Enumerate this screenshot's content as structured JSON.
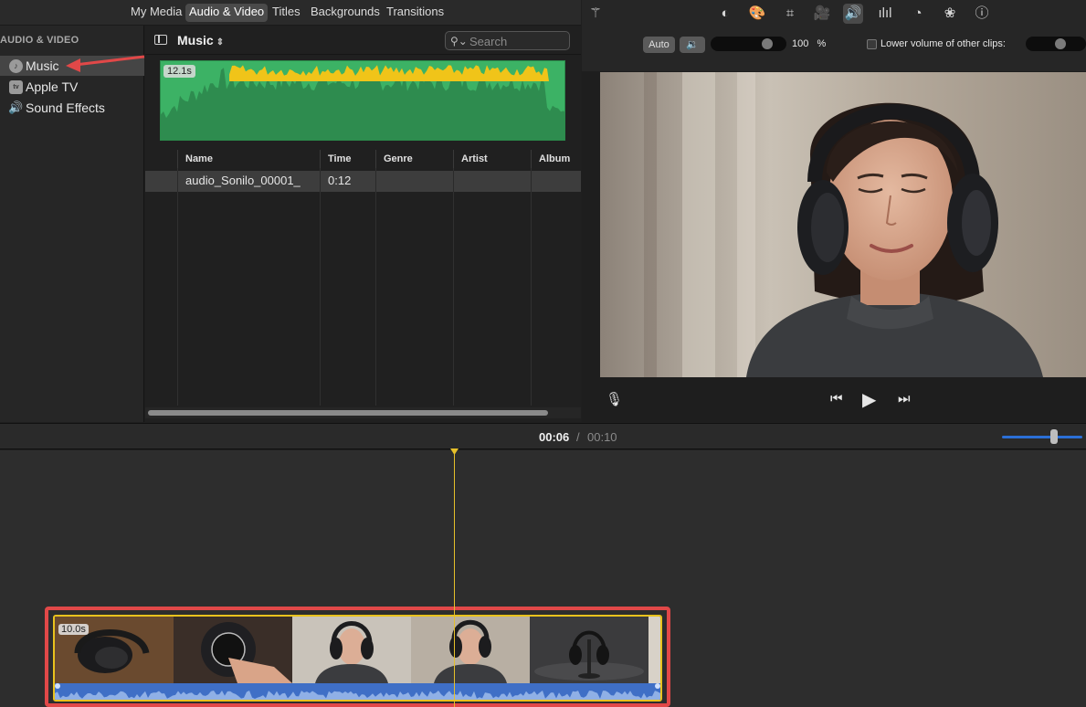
{
  "media_tabs": [
    "My Media",
    "Audio & Video",
    "Titles",
    "Backgrounds",
    "Transitions"
  ],
  "sidebar": {
    "heading": "AUDIO & VIDEO",
    "items": [
      {
        "label": "Music",
        "icon": "music-note-icon"
      },
      {
        "label": "Apple TV",
        "icon": "apple-tv-icon"
      },
      {
        "label": "Sound Effects",
        "icon": "speaker-icon"
      }
    ]
  },
  "library": {
    "source": "Music",
    "search_placeholder": "Search",
    "preview_duration": "12.1s",
    "columns": [
      "Name",
      "Time",
      "Genre",
      "Artist",
      "Album"
    ],
    "rows": [
      {
        "name": "audio_Sonilo_00001_",
        "time": "0:12",
        "genre": "",
        "artist": "",
        "album": ""
      }
    ]
  },
  "viewer": {
    "auto_label": "Auto",
    "volume_value": "100",
    "volume_unit": "%",
    "lower_volume_label": "Lower volume of other clips:"
  },
  "timeline": {
    "current_time": "00:06",
    "separator": "/",
    "total_time": "00:10",
    "clip_duration": "10.0s",
    "zoom_level": 0.65
  },
  "colors": {
    "accent": "#2b6fd6",
    "waveform_green": "#3cb265",
    "waveform_yellow": "#f0c419",
    "clip_border": "#e9c21d",
    "highlight": "#e14848",
    "audio_blue": "#3f6fc6"
  }
}
